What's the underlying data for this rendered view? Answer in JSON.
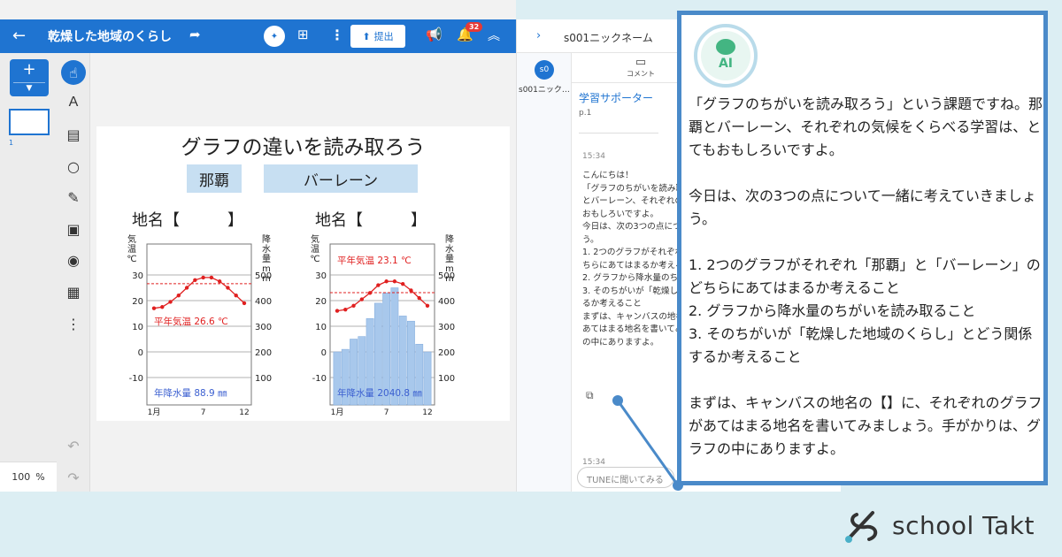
{
  "topbar": {
    "back_icon": "arrow-left",
    "title": "乾燥した地域のくらし",
    "share_icon": "share-arrow",
    "ai_icon": "ai-grid",
    "present_icon": "presentation",
    "more_icon": "vertical-dots",
    "submit_label": "提出",
    "submit_icon": "upload-arrow",
    "announce_icon": "megaphone",
    "notification_icon": "bell",
    "notification_count": "32",
    "collapse_icon": "chevron-up-double"
  },
  "pages": {
    "add_icon": "+",
    "page_number": "1",
    "zoom_value": "100",
    "zoom_unit": "%"
  },
  "toolbar": {
    "tools": [
      "pointer-hand",
      "text-A",
      "sticky-note",
      "circle",
      "pencil",
      "image",
      "camera",
      "table-grid",
      "more-dots"
    ],
    "undo_icon": "undo",
    "redo_icon": "redo"
  },
  "slide": {
    "title": "グラフの違いを読み取ろう",
    "tag_left": "那覇",
    "tag_right": "バーレーン",
    "place_left": "地名【　　　】",
    "place_right": "地名【　　　】"
  },
  "chart_data": [
    {
      "type": "line",
      "title": "",
      "ylabel_left": "気温 ℃",
      "ylabel_right": "降水量 mm",
      "x": [
        1,
        2,
        3,
        4,
        5,
        6,
        7,
        8,
        9,
        10,
        11,
        12
      ],
      "xticks": [
        "1月",
        "7",
        "12"
      ],
      "ylim_left": [
        -10,
        30
      ],
      "yticks_left": [
        "30",
        "20",
        "10",
        "0",
        "-10"
      ],
      "yticks_right": [
        "500",
        "400",
        "300",
        "200",
        "100"
      ],
      "series": [
        {
          "name": "気温",
          "values": [
            17,
            17.5,
            19.5,
            22,
            25,
            28,
            29,
            29,
            27.5,
            25,
            22,
            19
          ]
        },
        {
          "name": "平年気温",
          "values": [
            26.6,
            26.6,
            26.6,
            26.6,
            26.6,
            26.6,
            26.6,
            26.6,
            26.6,
            26.6,
            26.6,
            26.6
          ]
        }
      ],
      "annotations": [
        "平年気温 26.6 ℃",
        "年降水量 88.9 ㎜"
      ],
      "grid": true
    },
    {
      "type": "line",
      "title": "",
      "ylabel_left": "気温 ℃",
      "ylabel_right": "降水量 mm",
      "x": [
        1,
        2,
        3,
        4,
        5,
        6,
        7,
        8,
        9,
        10,
        11,
        12
      ],
      "xticks": [
        "1月",
        "7",
        "12"
      ],
      "ylim_left": [
        -10,
        30
      ],
      "yticks_left": [
        "30",
        "20",
        "10",
        "0",
        "-10"
      ],
      "yticks_right": [
        "500",
        "400",
        "300",
        "200",
        "100"
      ],
      "series": [
        {
          "name": "気温",
          "values": [
            16,
            16.5,
            18,
            20.5,
            23,
            26,
            27.5,
            27.5,
            26.5,
            24,
            21,
            18
          ]
        },
        {
          "name": "平年気温",
          "values": [
            23.1,
            23.1,
            23.1,
            23.1,
            23.1,
            23.1,
            23.1,
            23.1,
            23.1,
            23.1,
            23.1,
            23.1
          ]
        },
        {
          "name": "降水量",
          "values": [
            100,
            110,
            150,
            160,
            230,
            290,
            330,
            350,
            240,
            220,
            130,
            100
          ]
        }
      ],
      "annotations": [
        "平年気温 23.1 ℃",
        "年降水量 2040.8 ㎜"
      ],
      "grid": true
    }
  ],
  "panel": {
    "chevron_icon": "chevron-right",
    "user_title": "s001ニックネーム",
    "like_icon": "thumb-up",
    "user_avatar": "s0",
    "user_name": "s001ニック…",
    "tab_comment": "コメント",
    "tab_comment_icon": "comment",
    "supporter": "学習サポーター",
    "page_ref": "p.1",
    "time1": "15:34",
    "message": "こんにちは！\n「グラフのちがいを読み取ろう」という課題ですね。那覇\nとバーレーン、それぞれの気候をくらべる学習は、とても\nおもしろいですよ。\n今日は、次の3つの点について一緒に考えていきましょ\nう。\n1. 2つのグラフがそれぞれ「那覇」と「バーレーン」のど\nちらにあてはまるか考えること\n2. グラフから降水量のちがいを読み取ること\n3. そのちがいが「乾燥した地域のくらし」とどう関係す\nるか考えること\nまずは、キャンバスの地名の【】に、それぞれのグラフが\nあてはまる地名を書いてみましょう。手がかりは、グラフ\nの中にありますよ。",
    "copy_icon": "copy",
    "time2": "15:34",
    "input_placeholder": "TUNEに聞いてみる"
  },
  "callout": {
    "ai_label": "AI",
    "text": "「グラフのちがいを読み取ろう」という課題ですね。那覇とバーレーン、それぞれの気候をくらべる学習は、とてもおもしろいですよ。\n\n今日は、次の3つの点について一緒に考えていきましょう。\n\n1. 2つのグラフがそれぞれ「那覇」と「バーレーン」のどちらにあてはまるか考えること\n2. グラフから降水量のちがいを読み取ること\n3. そのちがいが「乾燥した地域のくらし」とどう関係するか考えること\n\nまずは、キャンバスの地名の【】に、それぞれのグラフがあてはまる地名を書いてみましょう。手がかりは、グラフの中にありますよ。"
  },
  "brand": {
    "name": "school Takt",
    "colors": {
      "accent": "#1f74d1",
      "callout": "#4a8ac9",
      "temp": "#e02020",
      "rain": "#a8c8ec"
    }
  }
}
